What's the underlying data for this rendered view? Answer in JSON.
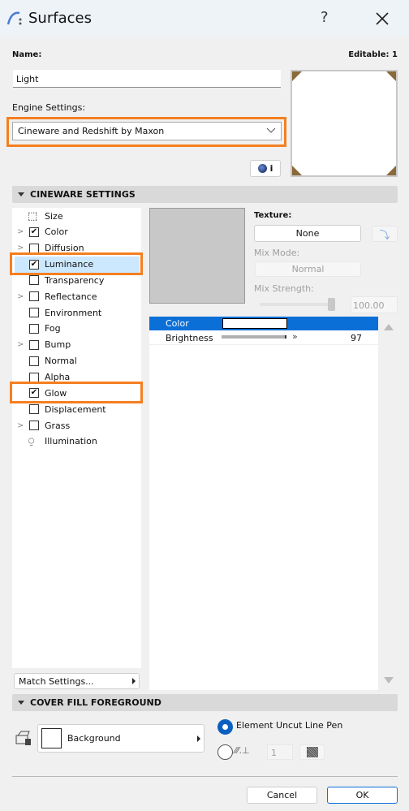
{
  "title": "Surfaces",
  "help": "?",
  "name_label": "Name:",
  "editable": "Editable: 1",
  "name_value": "Light",
  "engine_label": "Engine Settings:",
  "engine_value": "Cineware and Redshift by Maxon",
  "cineware_info": "i",
  "section1": "CINEWARE SETTINGS",
  "channels": [
    {
      "label": "Size",
      "type": "size",
      "expand": false
    },
    {
      "label": "Color",
      "checked": true,
      "expand": true
    },
    {
      "label": "Diffusion",
      "checked": false,
      "expand": true
    },
    {
      "label": "Luminance",
      "checked": true,
      "expand": false,
      "selected": true
    },
    {
      "label": "Transparency",
      "checked": false,
      "expand": false
    },
    {
      "label": "Reflectance",
      "checked": false,
      "expand": true
    },
    {
      "label": "Environment",
      "checked": false,
      "expand": false
    },
    {
      "label": "Fog",
      "checked": false,
      "expand": false
    },
    {
      "label": "Bump",
      "checked": false,
      "expand": true
    },
    {
      "label": "Normal",
      "checked": false,
      "expand": false
    },
    {
      "label": "Alpha",
      "checked": false,
      "expand": false
    },
    {
      "label": "Glow",
      "checked": true,
      "expand": false
    },
    {
      "label": "Displacement",
      "checked": false,
      "expand": false
    },
    {
      "label": "Grass",
      "checked": false,
      "expand": true
    },
    {
      "label": "Illumination",
      "type": "illum",
      "expand": false
    }
  ],
  "texture_label": "Texture:",
  "texture_value": "None",
  "mix_mode_label": "Mix Mode:",
  "mix_mode_value": "Normal",
  "mix_strength_label": "Mix Strength:",
  "mix_strength_value": "100.00",
  "params": {
    "color_label": "Color",
    "color_value": "#ffffff",
    "brightness_label": "Brightness",
    "brightness_value": "97"
  },
  "match_settings": "Match Settings...",
  "section2": "COVER FILL FOREGROUND",
  "fill_value": "Background",
  "radio1_label": "Element Uncut Line Pen",
  "pen_value": "1",
  "cancel": "Cancel",
  "ok": "OK",
  "colors": {
    "accent": "#0a6fd6",
    "highlight": "#f57f20",
    "selected_row": "#cce8ff"
  }
}
